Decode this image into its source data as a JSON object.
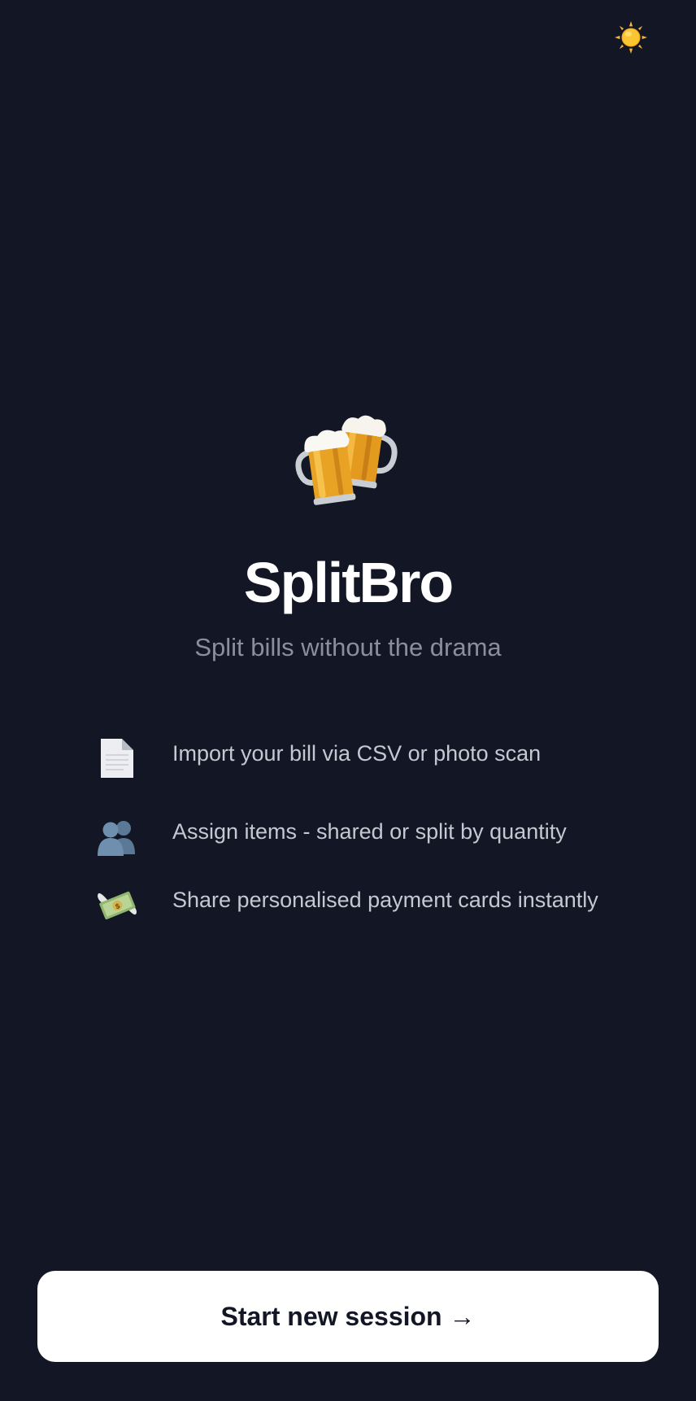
{
  "header": {
    "theme_toggle_icon": "sun-icon"
  },
  "hero": {
    "icon": "beer-mugs-icon",
    "title": "SplitBro",
    "tagline": "Split bills without the drama"
  },
  "features": [
    {
      "icon": "document-icon",
      "text": "Import your bill via CSV or photo scan"
    },
    {
      "icon": "people-icon",
      "text": "Assign items - shared or split by quantity"
    },
    {
      "icon": "money-wings-icon",
      "text": "Share personalised payment cards instantly"
    }
  ],
  "actions": {
    "start_label": "Start new session →"
  },
  "colors": {
    "background": "#131725",
    "title": "#ffffff",
    "tagline": "#8a8f9d",
    "feature_text": "#c5c8d0",
    "button_bg": "#ffffff",
    "button_text": "#131725"
  }
}
